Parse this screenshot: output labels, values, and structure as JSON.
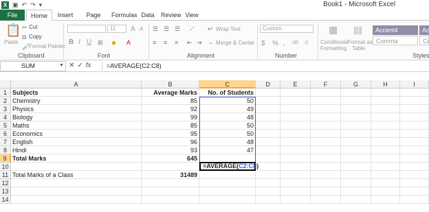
{
  "window": {
    "title": "Book1 - Microsoft Excel"
  },
  "ribbon": {
    "tabs": [
      "File",
      "Home",
      "Insert",
      "Page Layout",
      "Formulas",
      "Data",
      "Review",
      "View"
    ],
    "clipboard": {
      "label": "Clipboard",
      "paste": "Paste",
      "cut": "Cut",
      "copy": "Copy",
      "format_painter": "Format Painter"
    },
    "font": {
      "label": "Font",
      "size": "11",
      "grow": "A",
      "shrink": "A",
      "bold": "B",
      "italic": "I",
      "underline": "U"
    },
    "alignment": {
      "label": "Alignment",
      "wrap_text": "Wrap Text",
      "merge_center": "Merge & Center"
    },
    "number": {
      "label": "Number",
      "format": "Custom",
      "currency": "$",
      "percent": "%",
      "comma": ",",
      "inc_decimal": ".00",
      "dec_decimal": ".0"
    },
    "styles": {
      "label": "Styles",
      "conditional": "Conditional",
      "formatting": "Formatting",
      "format_as": "Format as",
      "table": "Table",
      "accent4": "Accent4",
      "comma_style": "Comma",
      "accent_cut": "Ac",
      "comma_cut": "Co"
    }
  },
  "formula_bar": {
    "name_box": "SUM",
    "cancel": "✕",
    "enter": "✓",
    "fx": "fx",
    "formula": "=AVERAGE(C2:C8)"
  },
  "grid": {
    "columns": [
      "A",
      "B",
      "C",
      "D",
      "E",
      "F",
      "G",
      "H",
      "I"
    ],
    "rows": [
      [
        "Subjects",
        "Average Marks",
        "No. of Students"
      ],
      [
        "Chemistry",
        "85",
        "50"
      ],
      [
        "Physics",
        "92",
        "49"
      ],
      [
        "Biology",
        "99",
        "48"
      ],
      [
        "Maths",
        "85",
        "50"
      ],
      [
        "Economics",
        "95",
        "50"
      ],
      [
        "English",
        "96",
        "48"
      ],
      [
        "Hindi",
        "93",
        "47"
      ],
      [
        "Total Marks",
        "645",
        ""
      ],
      [
        "",
        "",
        ""
      ],
      [
        "Total Marks of a Class",
        "31489",
        ""
      ],
      [
        "",
        "",
        ""
      ],
      [
        "",
        "",
        ""
      ],
      [
        "",
        "",
        ""
      ]
    ],
    "row_numbers": [
      "1",
      "2",
      "3",
      "4",
      "5",
      "6",
      "7",
      "8",
      "9",
      "10",
      "11",
      "12",
      "13",
      "14"
    ],
    "active_cell": {
      "prefix": "=AVERAGE(",
      "ref": "C2:C8",
      "suffix": ")"
    }
  },
  "colors": {
    "excel_green": "#1e7145",
    "header_selected": "#ffd58d",
    "range_blue": "#3d57d5"
  }
}
